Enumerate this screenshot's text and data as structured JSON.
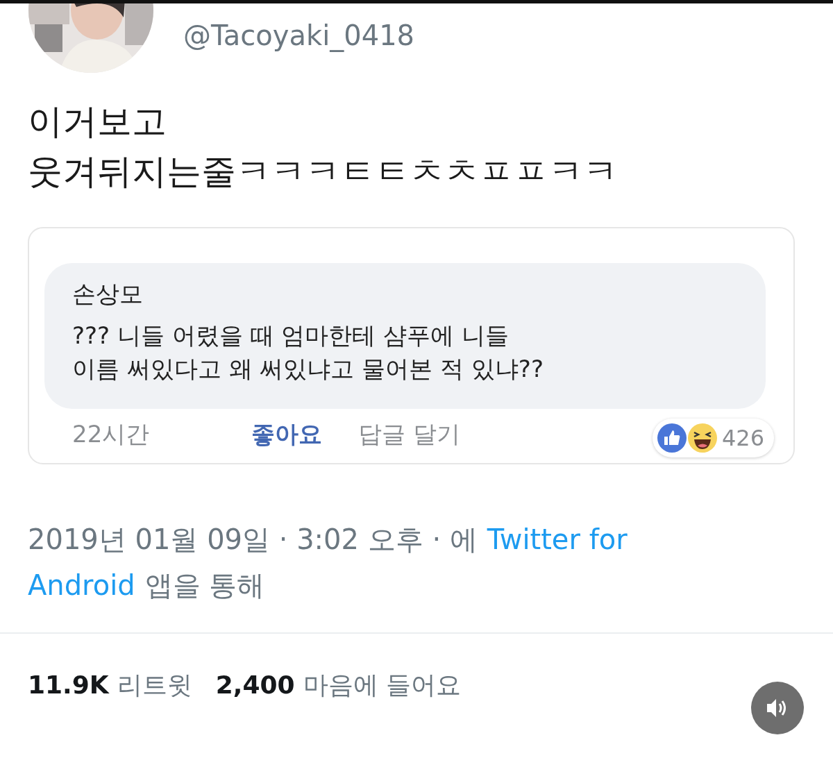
{
  "author": {
    "handle": "@Tacoyaki_0418"
  },
  "tweet_text": [
    "이거보고",
    "웃겨뒤지는줄ㅋㅋㅋㅌㅌㅊㅊㅍㅍㅋㅋ"
  ],
  "quoted_comment": {
    "name": "손상모",
    "text_lines": [
      "??? 니들 어렸을 때 엄마한테 샴푸에 니들",
      "이름 써있다고 왜 써있냐고 물어본 적 있냐??"
    ],
    "time": "22시간",
    "like": {
      "label": "좋아요",
      "selected": true
    },
    "reply": "답글 달기",
    "reaction_count": "426"
  },
  "timestamp": {
    "line1": "2019년 01월 09일 · 3:02 오후 · 에",
    "link_part1": "Twitter for",
    "link_part2": "Android",
    "suffix": "앱을 통해"
  },
  "stats": [
    {
      "count": "11.9K",
      "label": "리트윗"
    },
    {
      "count": "2,400",
      "label": "마음에 들어요"
    }
  ],
  "sound_button": {
    "on": true
  }
}
